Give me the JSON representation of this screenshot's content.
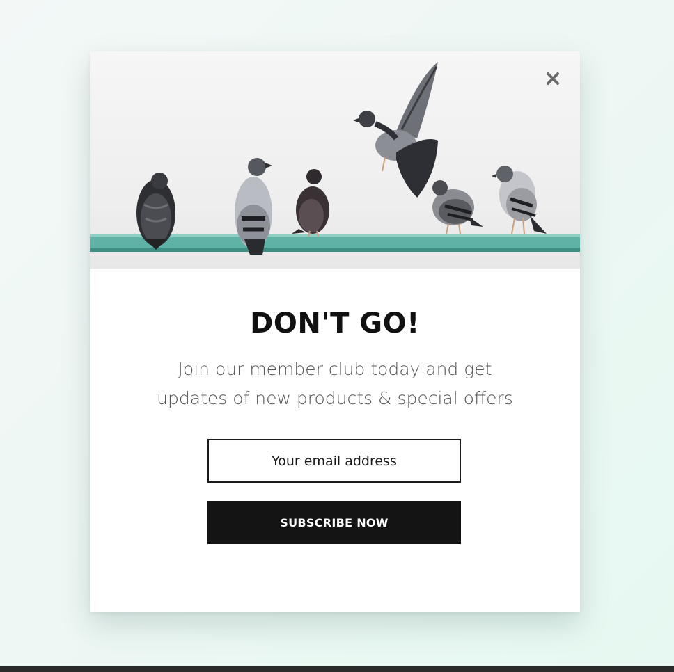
{
  "popup": {
    "headline": "DON'T GO!",
    "description_lines": [
      "Join our member club today and get",
      "updates of new products & special offers"
    ],
    "email_input": {
      "value": "",
      "placeholder": "Your email address"
    },
    "subscribe_label": "SUBSCRIBE NOW",
    "close_icon": "close-icon",
    "hero_image": "pigeons-on-rail-image"
  },
  "colors": {
    "background": "#eef7f4",
    "rail": "#5fb3a6",
    "button": "#141414",
    "button_text": "#ffffff",
    "headline": "#111111",
    "body_text": "#555555"
  }
}
